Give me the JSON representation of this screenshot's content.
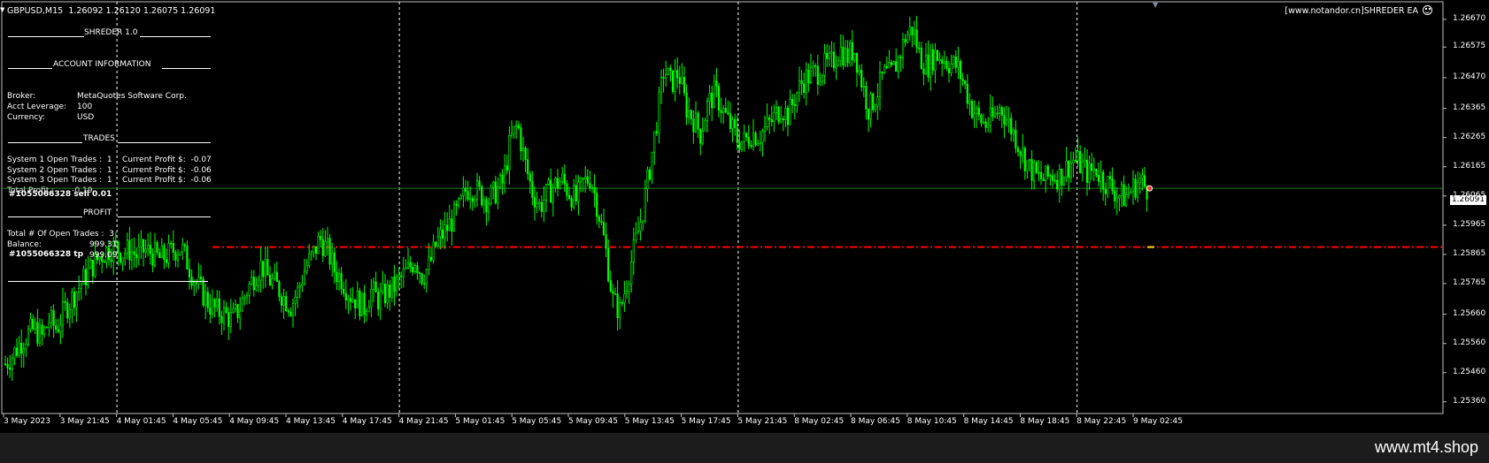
{
  "window": {
    "title": "GBPUSD,M15  1.26092 1.26120 1.26075 1.26091",
    "ea_name": "[www.notandor.cn]SHREDER EA"
  },
  "panel": {
    "header": "SHREDER 1.0",
    "account_section": "ACCOUNT INFORMATION",
    "broker_label": "Broker:",
    "broker_value": "MetaQuotes Software Corp.",
    "leverage_label": "Acct Leverage:",
    "leverage_value": "100",
    "currency_label": "Currency:",
    "currency_value": "USD",
    "trades_section": "TRADES",
    "system1": "System 1 Open Trades :  1    Current Profit $:  -0.07",
    "system2": "System 2 Open Trades :  1    Current Profit $:  -0.06",
    "system3": "System 3 Open Trades :  1    Current Profit $:  -0.06",
    "total_profit": "Total Profit :       -0.19",
    "order_sell": "#1055066328 sell 0.01",
    "profit_section": "PROFIT",
    "open_trades_total": "Total # Of Open Trades :  3",
    "balance_label": "Balance:",
    "balance_value": "999.31",
    "order_tp": "#1055066328 tp",
    "equity_value": "999.09"
  },
  "price_axis": [
    "1.26670",
    "1.26575",
    "1.26470",
    "1.26365",
    "1.26265",
    "1.26165",
    "1.26065",
    "1.25965",
    "1.25865",
    "1.25765",
    "1.25660",
    "1.25560",
    "1.25460",
    "1.25360"
  ],
  "current_price": "1.26091",
  "time_axis": [
    "3 May 2023",
    "3 May 21:45",
    "4 May 01:45",
    "4 May 05:45",
    "4 May 09:45",
    "4 May 13:45",
    "4 May 17:45",
    "4 May 21:45",
    "5 May 01:45",
    "5 May 05:45",
    "5 May 09:45",
    "5 May 13:45",
    "5 May 17:45",
    "5 May 21:45",
    "8 May 02:45",
    "8 May 06:45",
    "8 May 10:45",
    "8 May 14:45",
    "8 May 18:45",
    "8 May 22:45",
    "9 May 02:45"
  ],
  "footer": {
    "brand": "www.mt4.shop"
  },
  "colors": {
    "candles": "#00ff00",
    "tp_line": "#ff0000",
    "bid_line": "#1f7a1f",
    "separators": "#ffffff"
  },
  "chart_data": {
    "type": "candlestick",
    "symbol": "GBPUSD",
    "timeframe": "M15",
    "ylim": [
      1.2532,
      1.2673
    ],
    "current_price": 1.26091,
    "tp_level": 1.2589,
    "period_separators": [
      "4 May 01:45",
      "4 May 21:45",
      "5 May 21:45",
      "8 May 22:45"
    ],
    "close_path": [
      1.2549,
      1.2552,
      1.2556,
      1.2559,
      1.2561,
      1.2558,
      1.2564,
      1.2561,
      1.2567,
      1.2571,
      1.2575,
      1.2579,
      1.2583,
      1.2586,
      1.2588,
      1.2589,
      1.2587,
      1.2588,
      1.2586,
      1.2588,
      1.2587,
      1.2585,
      1.2586,
      1.2588,
      1.2589,
      1.2583,
      1.2577,
      1.2573,
      1.2569,
      1.2567,
      1.2566,
      1.2564,
      1.2568,
      1.2574,
      1.2579,
      1.2583,
      1.2578,
      1.2576,
      1.2572,
      1.2569,
      1.2574,
      1.2582,
      1.2586,
      1.2592,
      1.2588,
      1.2581,
      1.2578,
      1.2573,
      1.2571,
      1.2568,
      1.2574,
      1.2571,
      1.2573,
      1.2575,
      1.2578,
      1.2581,
      1.2585,
      1.2579,
      1.2583,
      1.2591,
      1.2594,
      1.2598,
      1.2602,
      1.2609,
      1.2609,
      1.2607,
      1.2605,
      1.2608,
      1.2611,
      1.2625,
      1.2631,
      1.2618,
      1.2608,
      1.2603,
      1.2607,
      1.261,
      1.2612,
      1.2608,
      1.2605,
      1.2611,
      1.2613,
      1.2602,
      1.2589,
      1.2571,
      1.2567,
      1.2578,
      1.2589,
      1.26,
      1.2615,
      1.2632,
      1.265,
      1.2645,
      1.2649,
      1.2637,
      1.2633,
      1.2628,
      1.2638,
      1.2642,
      1.2636,
      1.2631,
      1.2626,
      1.2625,
      1.2628,
      1.2627,
      1.263,
      1.2633,
      1.2637,
      1.2634,
      1.2641,
      1.2646,
      1.2648,
      1.2649,
      1.2651,
      1.2652,
      1.2657,
      1.2654,
      1.2657,
      1.2646,
      1.2636,
      1.2641,
      1.2648,
      1.2648,
      1.2653,
      1.2661,
      1.2664,
      1.2654,
      1.2651,
      1.2655,
      1.2654,
      1.2652,
      1.2651,
      1.2645,
      1.2637,
      1.2633,
      1.2631,
      1.2633,
      1.2637,
      1.2632,
      1.2627,
      1.2621,
      1.2616,
      1.2613,
      1.2612,
      1.2614,
      1.2613,
      1.2616,
      1.2619,
      1.2617,
      1.2614,
      1.2616,
      1.2612,
      1.261,
      1.2607,
      1.2606,
      1.2609,
      1.2612,
      1.2609
    ]
  }
}
